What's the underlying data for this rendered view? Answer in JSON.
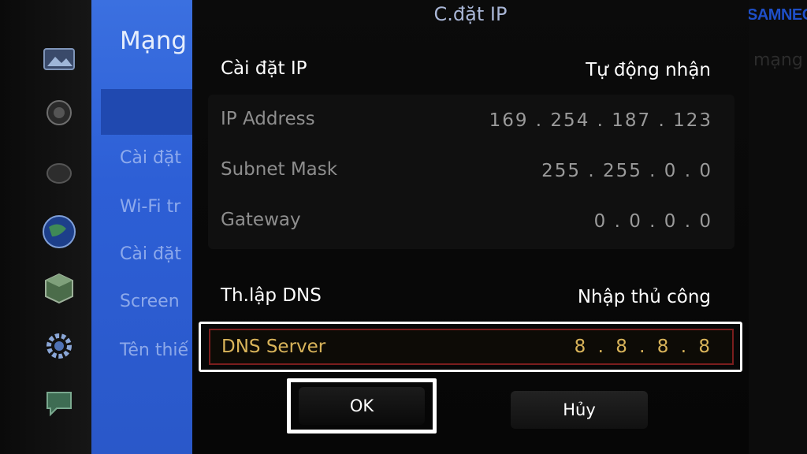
{
  "sidebar": {
    "title": "Mạng",
    "items": [
      "Cài đặt",
      "Wi-Fi tr",
      "Cài đặt",
      "Screen",
      "Tên thiế"
    ]
  },
  "dialog": {
    "title": "C.đặt IP",
    "ip_setting": {
      "label": "Cài đặt IP",
      "value": "Tự động nhận"
    },
    "ip_address": {
      "label": "IP Address",
      "value": "169 . 254 . 187 . 123"
    },
    "subnet_mask": {
      "label": "Subnet Mask",
      "value": "255 . 255 . 0 . 0"
    },
    "gateway": {
      "label": "Gateway",
      "value": "0 . 0 . 0 . 0"
    },
    "dns_setting": {
      "label": "Th.lập DNS",
      "value": "Nhập thủ công"
    },
    "dns_server": {
      "label": "DNS Server",
      "value": "8 . 8 . 8 . 8"
    },
    "ok_label": "OK",
    "cancel_label": "Hủy"
  },
  "logo": {
    "text": "SAMNEC"
  },
  "right_ghost": "mạng",
  "icons": [
    "picture-icon",
    "sound-icon",
    "broadcast-icon",
    "network-globe-icon",
    "system-cube-icon",
    "gear-icon",
    "support-icon"
  ],
  "colors": {
    "menu_blue": "#2d5fd6",
    "focus_gold": "#d9b45a",
    "focus_border": "#ffffff",
    "logo_blue": "#1e4fc8"
  }
}
